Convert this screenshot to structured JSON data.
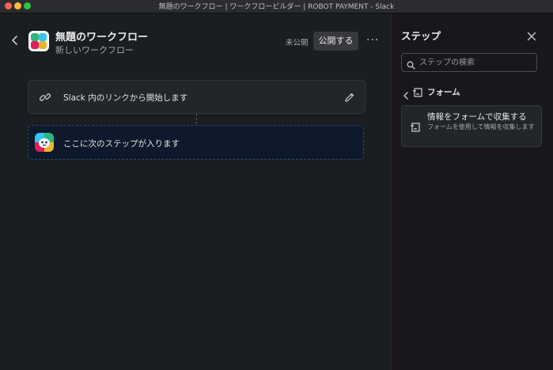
{
  "window": {
    "title": "無題のワークフロー | ワークフロービルダー | ROBOT PAYMENT - Slack"
  },
  "header": {
    "title": "無題のワークフロー",
    "subtitle": "新しいワークフロー",
    "status": "未公開",
    "publish_label": "公開する",
    "more_label": "···"
  },
  "canvas": {
    "trigger_label": "Slack 内のリンクから開始します",
    "placeholder_label": "ここに次のステップが入ります"
  },
  "sidebar": {
    "title": "ステップ",
    "search_placeholder": "ステップの検索",
    "breadcrumb": "フォーム",
    "step": {
      "name": "情報をフォームで収集する",
      "description": "フォームを使用して情報を収集します"
    }
  },
  "colors": {
    "background": "#1a1d21",
    "sidebar_background": "#19171d",
    "card": "#222529",
    "placeholder_card": "#0e1a2b",
    "logo_green": "#2eb67d",
    "logo_blue": "#36c5f0",
    "logo_red": "#e01e5a",
    "logo_yellow": "#ecb22e"
  },
  "icons": [
    "chevron-left-icon",
    "workflow-logo-icon",
    "link-icon",
    "pencil-icon",
    "robot-icon",
    "close-icon",
    "search-icon",
    "form-icon"
  ]
}
